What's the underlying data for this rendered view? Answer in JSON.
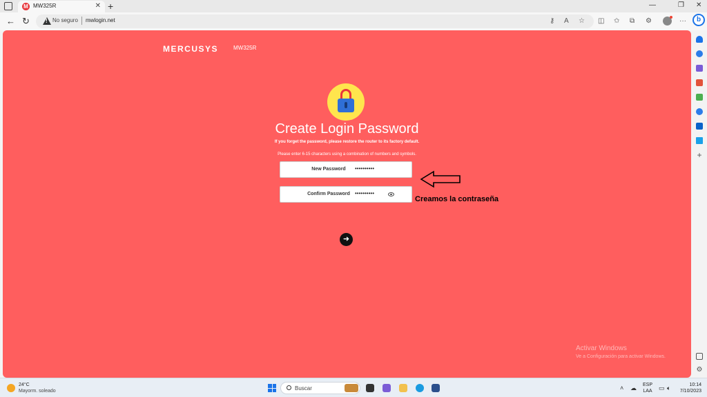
{
  "browser": {
    "tab_title": "MW325R",
    "tab_favicon_letter": "M",
    "not_secure_label": "No seguro",
    "url": "mwlogin.net",
    "bing_letter": "b"
  },
  "page": {
    "brand": "MERCUSYS",
    "model": "MW325R",
    "title": "Create Login Password",
    "hint_forgot": "If you forget the password, please restore the router to its factory default.",
    "hint_rules": "Please enter 6-15 characters using a combination of numbers and symbols.",
    "new_password_label": "New Password",
    "new_password_value": "••••••••••",
    "confirm_password_label": "Confirm Password",
    "confirm_password_value": "••••••••••",
    "annotation_text": "Creamos la contraseña",
    "watermark_title": "Activar Windows",
    "watermark_sub": "Ve a Configuración para activar Windows."
  },
  "taskbar": {
    "temperature": "24°C",
    "weather": "Mayorm. soleado",
    "search_placeholder": "Buscar",
    "language": "ESP",
    "keyboard": "LAA",
    "time": "10:14",
    "date": "7/10/2023"
  },
  "colors": {
    "page_background": "#ff5e5e",
    "lock_background": "#ffe54d",
    "lock_body": "#2f6fd6",
    "lock_shackle": "#e8363b"
  }
}
